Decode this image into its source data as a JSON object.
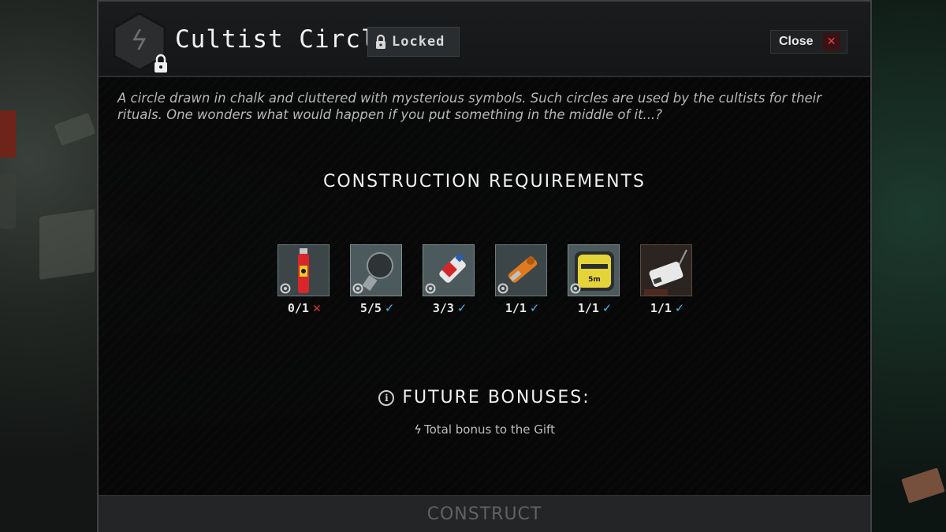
{
  "header": {
    "title": "Cultist Circle",
    "status_label": "Locked",
    "close_label": "Close",
    "close_glyph": "✕"
  },
  "description": "A circle drawn in chalk and cluttered with mysterious symbols. Such circles are used by the cultists for their rituals. One wonders what would happen if you put something in the middle of it...?",
  "requirements": {
    "title": "CONSTRUCTION REQUIREMENTS",
    "items": [
      {
        "icon": "insect-spray-can-icon",
        "count": "0/1",
        "met": false
      },
      {
        "icon": "light-bulb-icon",
        "count": "5/5",
        "met": true
      },
      {
        "icon": "aerosol-can-icon",
        "count": "3/3",
        "met": true
      },
      {
        "icon": "bolts-kit-icon",
        "count": "1/1",
        "met": true
      },
      {
        "icon": "tape-measure-icon",
        "count": "1/1",
        "met": true,
        "sublabel": "5m"
      },
      {
        "icon": "radio-transmitter-icon",
        "count": "1/1",
        "met": true
      }
    ]
  },
  "bonuses": {
    "title": "FUTURE BONUSES:",
    "line": "Total bonus to the Gift"
  },
  "construct_label": "CONSTRUCT",
  "colors": {
    "check": "#4fb8e8",
    "cross": "#e0363c",
    "accent_red": "#3b1214"
  }
}
